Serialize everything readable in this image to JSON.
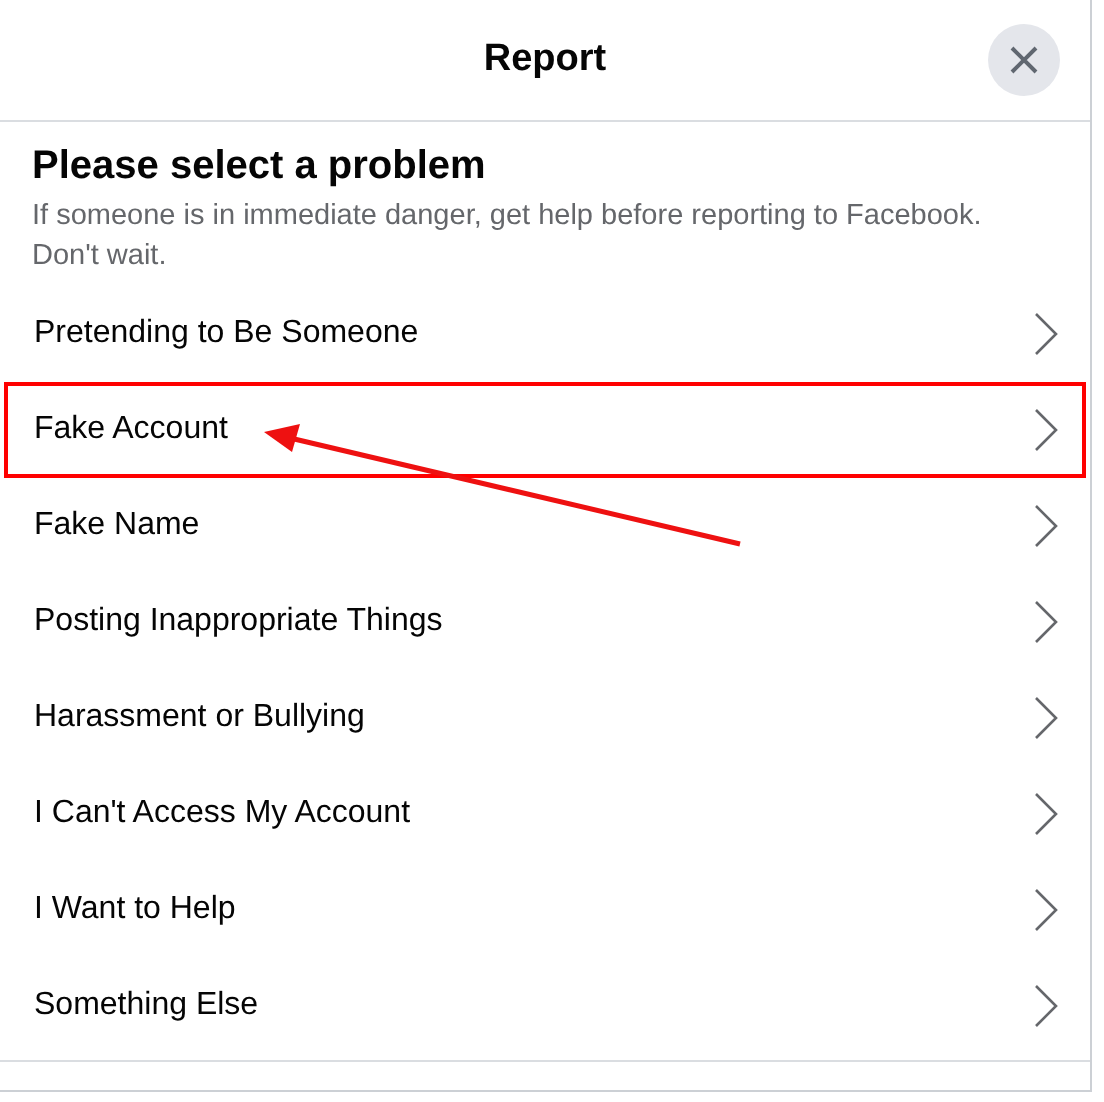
{
  "dialog": {
    "title": "Report"
  },
  "heading": "Please select a problem",
  "subtitle": "If someone is in immediate danger, get help before reporting to Facebook. Don't wait.",
  "items": [
    {
      "label": "Pretending to Be Someone",
      "highlighted": false
    },
    {
      "label": "Fake Account",
      "highlighted": true
    },
    {
      "label": "Fake Name",
      "highlighted": false
    },
    {
      "label": "Posting Inappropriate Things",
      "highlighted": false
    },
    {
      "label": "Harassment or Bullying",
      "highlighted": false
    },
    {
      "label": "I Can't Access My Account",
      "highlighted": false
    },
    {
      "label": "I Want to Help",
      "highlighted": false
    },
    {
      "label": "Something Else",
      "highlighted": false
    }
  ]
}
